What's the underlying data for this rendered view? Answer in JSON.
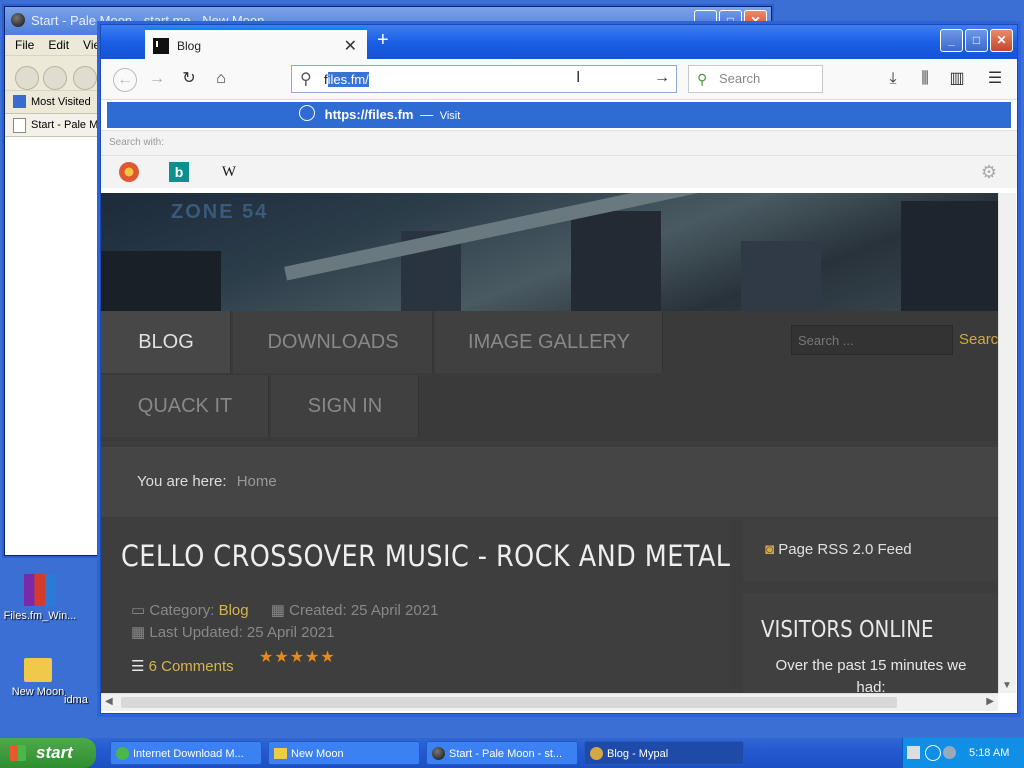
{
  "bg_window": {
    "title": "Start - Pale Moon - start.me - New Moon",
    "menu": [
      "File",
      "Edit",
      "View"
    ],
    "bookmark": "Most Visited",
    "tab": "Start - Pale Mo"
  },
  "desktop_icons": [
    {
      "label": "Files.fm_Win..."
    },
    {
      "label": "New Moon"
    },
    {
      "label": "idma"
    }
  ],
  "browser": {
    "tab_title": "Blog",
    "url_prefix": "f",
    "url_selected": "iles.fm/",
    "search_placeholder": "Search",
    "suggestion_url": "https://files.fm",
    "suggestion_sep": "—",
    "suggestion_action": "Visit",
    "search_with": "Search with:"
  },
  "site": {
    "logo": "ZONE 54",
    "menu": [
      "BLOG",
      "DOWNLOADS",
      "IMAGE GALLERY",
      "QUACK IT",
      "SIGN IN"
    ],
    "search_placeholder": "Search ...",
    "search_button": "Search",
    "breadcrumb_label": "You are here:",
    "breadcrumb_home": "Home",
    "article_title": "CELLO CROSSOVER MUSIC - ROCK AND METAL",
    "category_label": "Category:",
    "category": "Blog",
    "created": "Created: 25 April 2021",
    "updated": "Last Updated: 25 April 2021",
    "comments": "6 Comments",
    "rating": "★★★★★",
    "rating_value": 5,
    "rss": "Page RSS 2.0 Feed",
    "visitors_title": "VISITORS ONLINE",
    "visitors_text": "Over the past 15 minutes we had:"
  },
  "taskbar": {
    "start": "start",
    "items": [
      "Internet Download M...",
      "New Moon",
      "Start - Pale Moon - st...",
      "Blog - Mypal"
    ],
    "time": "5:18 AM"
  }
}
